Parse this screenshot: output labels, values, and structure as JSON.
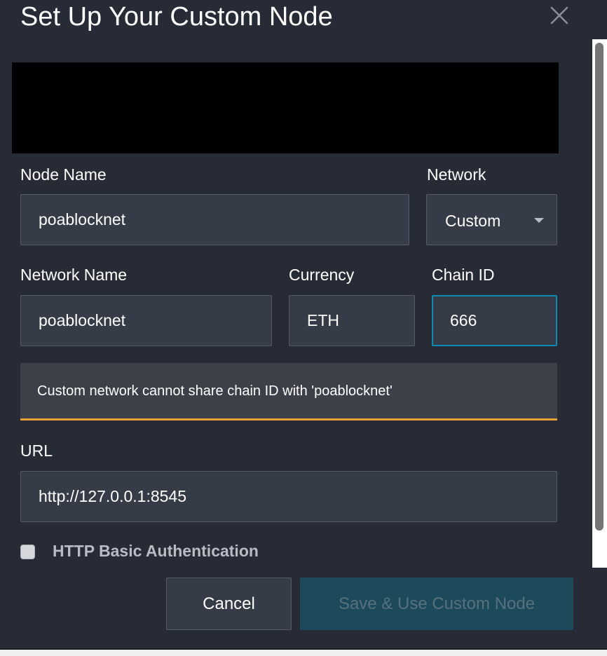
{
  "dialog": {
    "title": "Set Up Your Custom Node",
    "close_icon": "close-icon"
  },
  "form": {
    "node_name": {
      "label": "Node Name",
      "value": "poablocknet"
    },
    "network": {
      "label": "Network",
      "selected": "Custom"
    },
    "network_name": {
      "label": "Network Name",
      "value": "poablocknet"
    },
    "currency": {
      "label": "Currency",
      "value": "ETH"
    },
    "chain_id": {
      "label": "Chain ID",
      "value": "666"
    },
    "warning": "Custom network cannot share chain ID with 'poablocknet'",
    "url": {
      "label": "URL",
      "value": "http://127.0.0.1:8545"
    },
    "basic_auth": {
      "label": "HTTP Basic Authentication",
      "checked": false
    }
  },
  "buttons": {
    "cancel": "Cancel",
    "save": "Save & Use Custom Node"
  },
  "colors": {
    "background": "#262b36",
    "field": "#363b48",
    "focus_border": "#0f8bb3",
    "warning_border": "#e8a036",
    "save_button": "#1c4a5b"
  }
}
